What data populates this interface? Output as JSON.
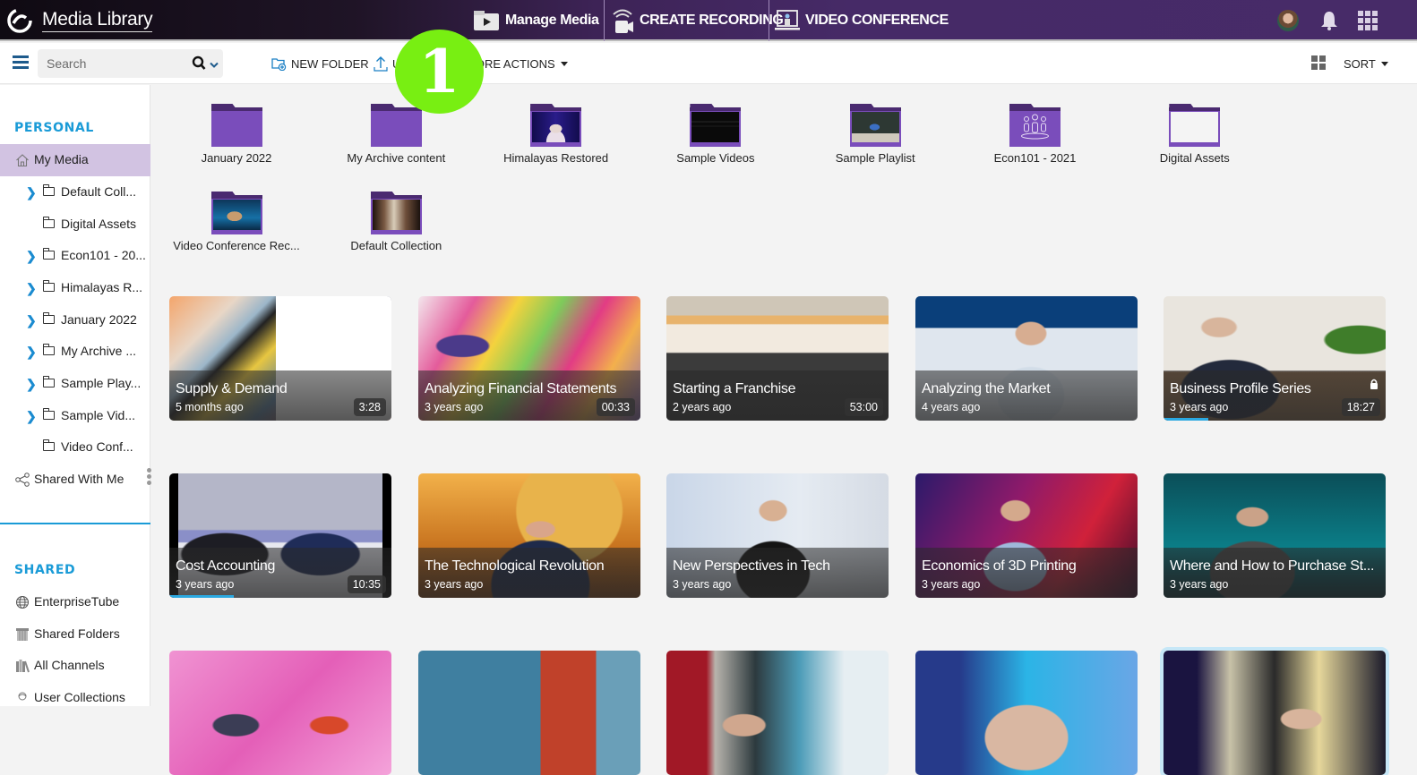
{
  "header": {
    "app_title": "Media Library",
    "nav": [
      {
        "label": "Manage Media",
        "icon": "media-folder-play-icon"
      },
      {
        "label": "CREATE RECORDING",
        "icon": "recording-camera-icon"
      },
      {
        "label": "VIDEO CONFERENCE",
        "icon": "video-conference-icon"
      }
    ],
    "icons": [
      "user-avatar",
      "notification-bell-icon",
      "apps-grid-icon"
    ]
  },
  "toolbar": {
    "search_placeholder": "Search",
    "search_value": "",
    "new_folder_label": "NEW FOLDER",
    "upload_label": "UPLOAD",
    "more_actions_label": "MORE ACTIONS",
    "sort_label": "SORT",
    "view_icon": "grid-view-icon"
  },
  "step_badge": "1",
  "sidebar": {
    "personal_title": "PERSONAL",
    "my_media": "My Media",
    "folders": [
      {
        "label": "Default Coll...",
        "expandable": true
      },
      {
        "label": "Digital Assets",
        "expandable": false
      },
      {
        "label": "Econ101 - 20...",
        "expandable": true
      },
      {
        "label": "Himalayas R...",
        "expandable": true
      },
      {
        "label": "January 2022",
        "expandable": true
      },
      {
        "label": "My Archive ...",
        "expandable": true
      },
      {
        "label": "Sample Play...",
        "expandable": true
      },
      {
        "label": "Sample Vid...",
        "expandable": true
      },
      {
        "label": "Video Conf...",
        "expandable": false
      }
    ],
    "shared_with_me": "Shared With Me",
    "shared_title": "SHARED",
    "shared_items": [
      {
        "label": "EnterpriseTube",
        "icon": "globe-icon"
      },
      {
        "label": "Shared Folders",
        "icon": "shared-folders-icon"
      },
      {
        "label": "All Channels",
        "icon": "channels-icon"
      },
      {
        "label": "User Collections",
        "icon": "user-collections-icon"
      }
    ]
  },
  "folders": [
    {
      "name": "January 2022",
      "thumb": "none"
    },
    {
      "name": "My Archive content",
      "thumb": "none"
    },
    {
      "name": "Himalayas Restored",
      "thumb": "speaker"
    },
    {
      "name": "Sample Videos",
      "thumb": "text-slide"
    },
    {
      "name": "Sample Playlist",
      "thumb": "lecture"
    },
    {
      "name": "Econ101 - 2021",
      "thumb": "group-icon"
    },
    {
      "name": "Digital Assets",
      "thumb": "white-slide"
    },
    {
      "name": "Video Conference Rec...",
      "thumb": "conference"
    },
    {
      "name": "Default Collection",
      "thumb": "movie"
    }
  ],
  "videos": [
    {
      "title": "Supply & Demand",
      "age": "5 months ago",
      "duration": "3:28",
      "locked": false,
      "progress": 0
    },
    {
      "title": "Analyzing Financial Statements",
      "age": "3 years ago",
      "duration": "00:33",
      "locked": false,
      "progress": 0
    },
    {
      "title": "Starting a Franchise",
      "age": "2 years ago",
      "duration": "53:00",
      "locked": false,
      "progress": 0
    },
    {
      "title": "Analyzing the Market",
      "age": "4 years ago",
      "duration": "",
      "locked": false,
      "progress": 0
    },
    {
      "title": "Business Profile Series",
      "age": "3 years ago",
      "duration": "18:27",
      "locked": true,
      "progress": 0.2
    },
    {
      "title": "Cost Accounting",
      "age": "3 years ago",
      "duration": "10:35",
      "locked": false,
      "progress": 0.29
    },
    {
      "title": "The Technological Revolution",
      "age": "3 years ago",
      "duration": "",
      "locked": false,
      "progress": 0
    },
    {
      "title": "New Perspectives in Tech",
      "age": "3 years ago",
      "duration": "",
      "locked": false,
      "progress": 0
    },
    {
      "title": "Economics of 3D Printing",
      "age": "3 years ago",
      "duration": "",
      "locked": false,
      "progress": 0
    },
    {
      "title": "Where and How to Purchase St...",
      "age": "3 years ago",
      "duration": "",
      "locked": false,
      "progress": 0
    },
    {
      "title": "",
      "age": "",
      "duration": "",
      "locked": false,
      "progress": 0
    },
    {
      "title": "",
      "age": "",
      "duration": "",
      "locked": false,
      "progress": 0
    },
    {
      "title": "",
      "age": "",
      "duration": "",
      "locked": false,
      "progress": 0
    },
    {
      "title": "",
      "age": "",
      "duration": "",
      "locked": false,
      "progress": 0
    },
    {
      "title": "",
      "age": "",
      "duration": "",
      "locked": false,
      "progress": 0
    }
  ]
}
